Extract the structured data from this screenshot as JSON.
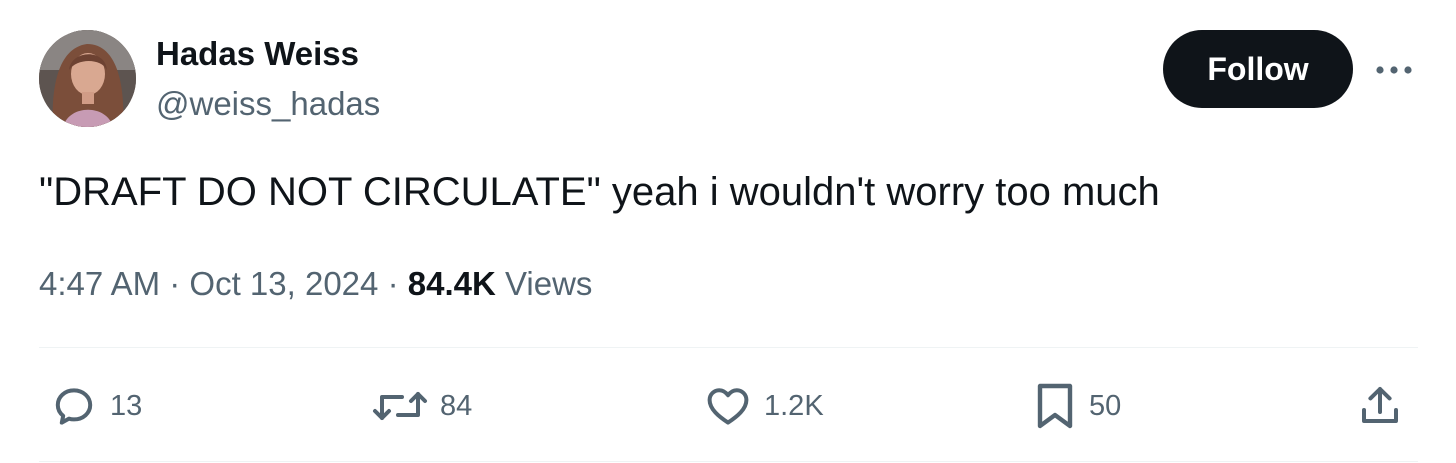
{
  "author": {
    "display_name": "Hadas Weiss",
    "handle": "@weiss_hadas"
  },
  "follow_button": {
    "label": "Follow"
  },
  "tweet": {
    "text": "\"DRAFT DO NOT CIRCULATE\" yeah i wouldn't worry too much",
    "time": "4:47 AM",
    "separator": "·",
    "date": "Oct 13, 2024",
    "views_count": "84.4K",
    "views_label": "Views"
  },
  "actions": {
    "replies": "13",
    "reposts": "84",
    "likes": "1.2K",
    "bookmarks": "50"
  },
  "icons": {
    "more": "more-horizontal-icon",
    "reply": "reply-icon",
    "repost": "repost-icon",
    "like": "heart-icon",
    "bookmark": "bookmark-icon",
    "share": "share-icon"
  },
  "colors": {
    "text_primary": "#0f1419",
    "text_secondary": "#536471",
    "button_bg": "#0f1419",
    "button_text": "#ffffff",
    "divider": "#eff3f4"
  }
}
